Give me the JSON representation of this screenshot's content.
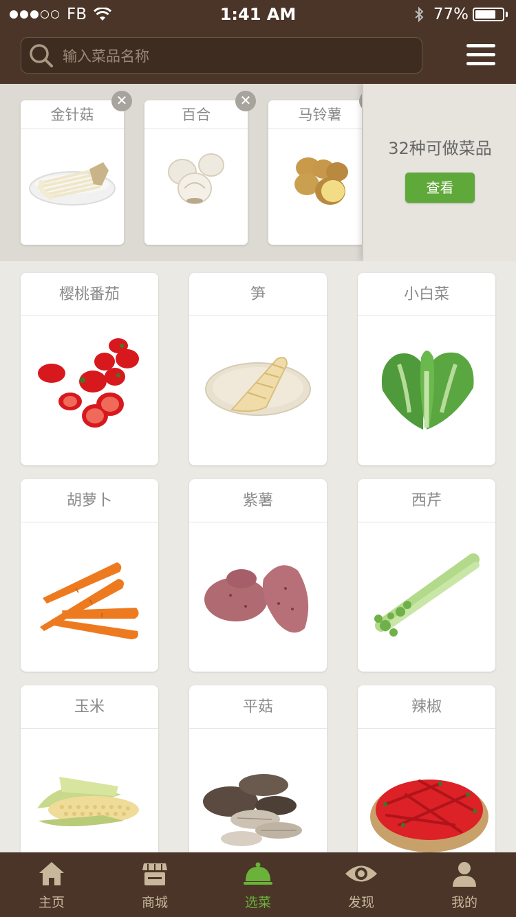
{
  "status_bar": {
    "carrier": "FB",
    "time": "1:41 AM",
    "battery": "77%",
    "battery_level": 0.77,
    "signal_bars_filled": 3,
    "signal_bars_total": 5
  },
  "search": {
    "placeholder": "输入菜品名称"
  },
  "selected": {
    "items": [
      {
        "name": "金针菇",
        "icon": "enoki-mushroom"
      },
      {
        "name": "百合",
        "icon": "lily-bulb"
      },
      {
        "name": "马铃薯",
        "icon": "potato"
      }
    ],
    "count_text": "32种可做菜品",
    "view_button": "查看"
  },
  "grid": {
    "items": [
      {
        "name": "樱桃番茄",
        "icon": "cherry-tomato"
      },
      {
        "name": "笋",
        "icon": "bamboo-shoot"
      },
      {
        "name": "小白菜",
        "icon": "bok-choy"
      },
      {
        "name": "胡萝卜",
        "icon": "carrot"
      },
      {
        "name": "紫薯",
        "icon": "purple-sweet-potato"
      },
      {
        "name": "西芹",
        "icon": "celery"
      },
      {
        "name": "玉米",
        "icon": "corn"
      },
      {
        "name": "平菇",
        "icon": "oyster-mushroom"
      },
      {
        "name": "辣椒",
        "icon": "chili-pepper"
      }
    ]
  },
  "tabs": [
    {
      "label": "主页",
      "icon": "home-icon"
    },
    {
      "label": "商城",
      "icon": "shop-icon"
    },
    {
      "label": "选菜",
      "icon": "dish-cover-icon",
      "active": true
    },
    {
      "label": "发现",
      "icon": "eye-icon"
    },
    {
      "label": "我的",
      "icon": "user-icon"
    }
  ],
  "colors": {
    "header_bg": "#4a3528",
    "accent_green": "#5fa83a",
    "tab_inactive": "#c9b79c",
    "tab_active": "#6ab23a"
  }
}
